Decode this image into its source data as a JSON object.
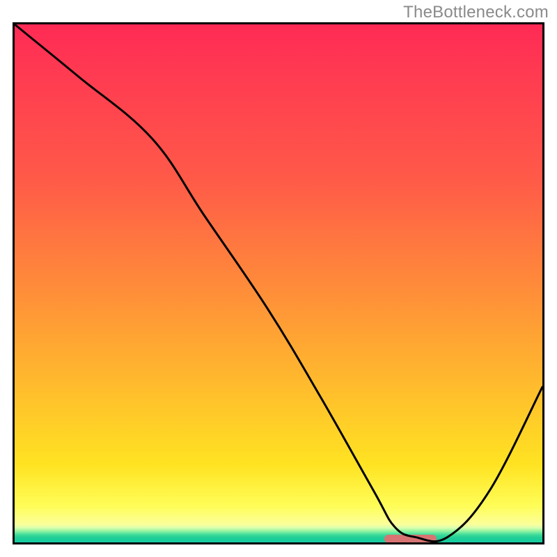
{
  "watermark": "TheBottleneck.com",
  "chart_data": {
    "type": "line",
    "title": "",
    "xlabel": "",
    "ylabel": "",
    "xlim": [
      0,
      100
    ],
    "ylim": [
      0,
      100
    ],
    "grid": false,
    "series": [
      {
        "name": "curve",
        "x": [
          0,
          12,
          26,
          36,
          48,
          58,
          68,
          72,
          76,
          82,
          90,
          100
        ],
        "values": [
          100,
          90,
          78,
          63,
          45,
          28,
          10,
          3,
          1,
          1,
          10,
          30
        ]
      }
    ],
    "marker": {
      "x_start": 70,
      "x_end": 80,
      "y": 0.7,
      "color": "#d97373"
    },
    "frame": {
      "inner_w": 758,
      "inner_h": 744
    }
  }
}
